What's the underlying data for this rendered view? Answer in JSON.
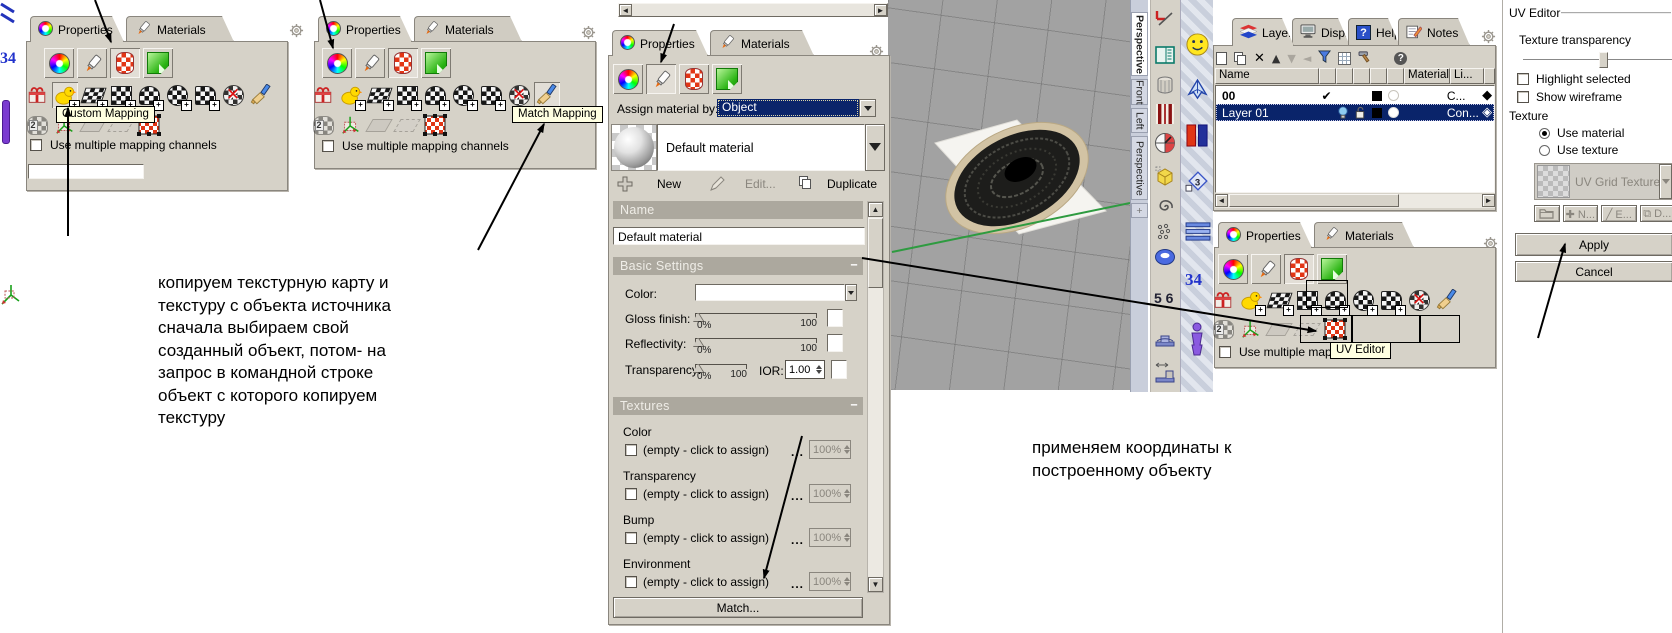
{
  "panels": {
    "left1": {
      "tabs": [
        "Properties",
        "Materials"
      ],
      "tooltip": "Custom Mapping",
      "checkbox": "Use multiple mapping channels"
    },
    "left2": {
      "tabs": [
        "Properties",
        "Materials"
      ],
      "tooltip": "Match Mapping",
      "checkbox": "Use multiple mapping channels"
    },
    "right": {
      "tabs": [
        "Properties",
        "Materials"
      ],
      "tooltip": "UV Editor",
      "checkbox": "Use multiple mappin"
    }
  },
  "material_editor": {
    "tabs": [
      "Properties",
      "Materials"
    ],
    "assign_label": "Assign material by:",
    "assign_value": "Object",
    "preview_name": "Default material",
    "actions": {
      "new": "New",
      "edit": "Edit...",
      "duplicate": "Duplicate"
    },
    "name_section": {
      "title": "Name",
      "value": "Default material"
    },
    "basic_section": {
      "title": "Basic Settings",
      "color_label": "Color:",
      "sliders": [
        {
          "label": "Gloss finish:",
          "min": "0%",
          "max": "100"
        },
        {
          "label": "Reflectivity:",
          "min": "0%",
          "max": "100"
        },
        {
          "label": "Transparency:",
          "min": "0%",
          "max": "100"
        }
      ],
      "ior_label": "IOR:",
      "ior_value": "1.00"
    },
    "textures_section": {
      "title": "Textures",
      "channels": [
        "Color",
        "Transparency",
        "Bump",
        "Environment"
      ],
      "empty_label": "(empty - click to assign)",
      "browse_label": "...",
      "amount": "100%"
    },
    "match_button": "Match..."
  },
  "viewport": {
    "view_tabs": [
      "Perspective",
      "Front",
      "Left",
      "Perspective"
    ],
    "add_tab": "+"
  },
  "side_toolbar": {
    "num34": "34",
    "num56": "5 6",
    "far_left_num": "34"
  },
  "layers": {
    "tabs": [
      "Laye...",
      "Displ...",
      "Help",
      "Notes"
    ],
    "columns": {
      "name": "Name",
      "material": "Material",
      "linetype": "Li..."
    },
    "rows": [
      {
        "name": "00",
        "linetype": "C...",
        "current": true,
        "selected": false
      },
      {
        "name": "Layer 01",
        "linetype": "Con...",
        "current": false,
        "selected": true
      }
    ]
  },
  "uv_editor": {
    "title": "UV Editor",
    "transparency_label": "Texture transparency",
    "highlight_checkbox": "Highlight selected",
    "wireframe_checkbox": "Show wireframe",
    "texture_group": "Texture",
    "radio_material": "Use material",
    "radio_texture": "Use texture",
    "texture_dropdown": "UV Grid Texture",
    "mini_buttons": [
      "N...",
      "E...",
      "D..."
    ],
    "apply": "Apply",
    "cancel": "Cancel"
  },
  "notes": {
    "left": "копируем текстурную карту и\nтекстуру с объекта источника\nсначала выбираем  свой\nсозданный объект, потом- на\nзапрос в командной строке\nобъект  с которого копируем\nтекстуру",
    "right": "применяем координаты к\nпостроенному объекту"
  },
  "colors": {
    "selection": "#0a246a",
    "panel": "#d6d2c8",
    "tooltip": "#ffffe1",
    "viewport_bg": "#a2a2a2",
    "axis_green": "#2e9b40"
  }
}
